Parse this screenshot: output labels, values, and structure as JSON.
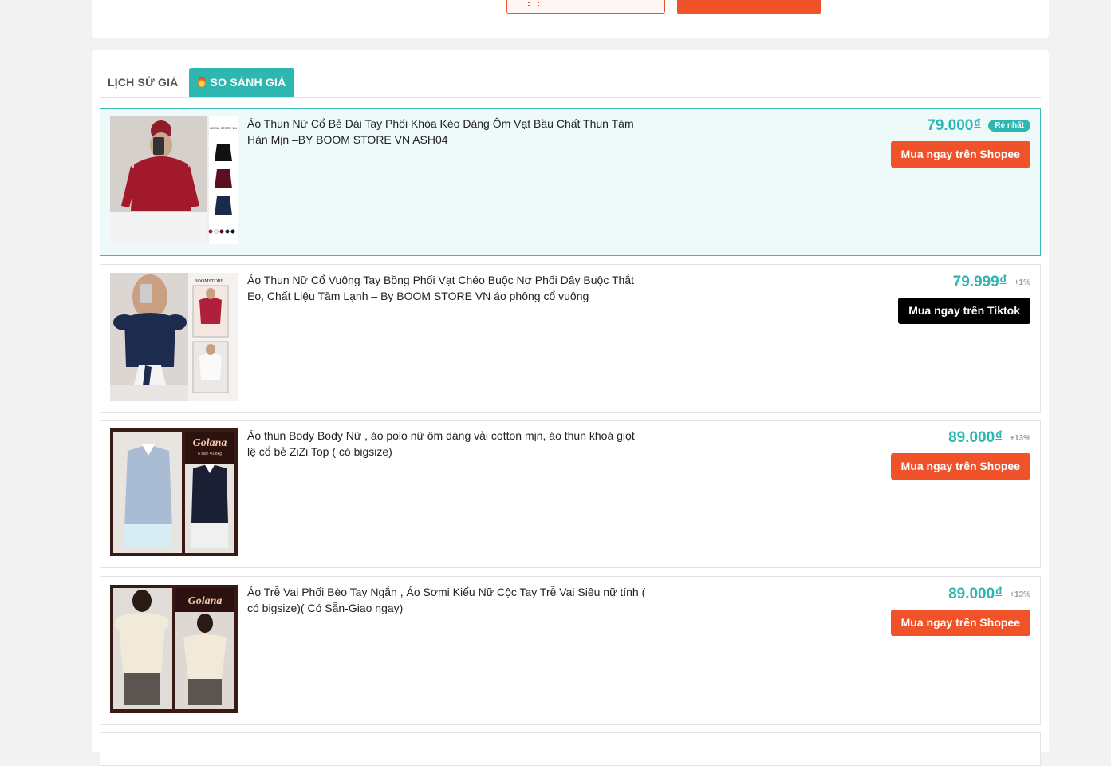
{
  "tabs": {
    "history": "LỊCH SỬ GIÁ",
    "compare": "SO SÁNH GIÁ"
  },
  "products": [
    {
      "title": "Áo Thun Nữ Cổ Bẻ Dài Tay Phối Khóa Kéo Dáng Ôm Vạt Bầu Chất Thun Tăm Hàn Mịn –BY BOOM STORE VN ASH04",
      "price": "79.000",
      "currency": "đ",
      "badge": "Rẻ nhất",
      "button": "Mua ngay trên Shopee",
      "store": "shopee",
      "thumb_label": "BOOM STORE VN"
    },
    {
      "title": "Áo Thun Nữ Cổ Vuông Tay Bồng Phối Vạt Chéo Buộc Nơ Phối Dây Buộc Thắt Eo, Chất Liệu Tăm Lạnh – By BOOM STORE VN áo phông cổ vuông",
      "price": "79.999",
      "currency": "đ",
      "diff": "+1%",
      "button": "Mua ngay trên Tiktok",
      "store": "tiktok",
      "thumb_label": "BOOMSTORE"
    },
    {
      "title": "Áo thun Body Body Nữ , áo polo nữ ôm dáng vải cotton mịn, áo thun khoá giọt lệ cổ bẻ ZiZi Top ( có bigsize)",
      "price": "89.000",
      "currency": "đ",
      "diff": "+13%",
      "button": "Mua ngay trên Shopee",
      "store": "shopee",
      "thumb_label": "Golana",
      "thumb_sub": "6 size 40-8kg"
    },
    {
      "title": "Áo Trễ Vai Phối Bèo Tay Ngắn , Áo Sơmi Kiểu Nữ Cộc Tay Trễ Vai Siêu nữ tính ( có bigsize)( Có Sẵn-Giao ngay)",
      "price": "89.000",
      "currency": "đ",
      "diff": "+13%",
      "button": "Mua ngay trên Shopee",
      "store": "shopee",
      "thumb_label": "Golana"
    }
  ],
  "colors": {
    "accent": "#2eb6b0",
    "shopee": "#f0522a",
    "tiktok": "#000000"
  }
}
